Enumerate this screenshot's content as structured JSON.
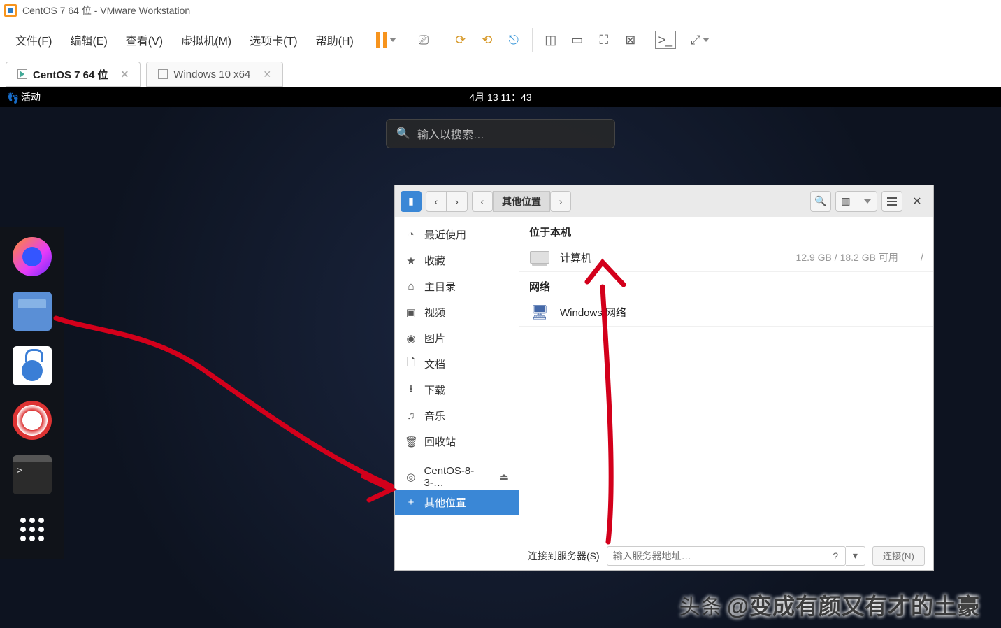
{
  "titlebar": {
    "text": "CentOS 7 64 位 - VMware Workstation"
  },
  "menubar": {
    "items": [
      "文件(F)",
      "编辑(E)",
      "查看(V)",
      "虚拟机(M)",
      "选项卡(T)",
      "帮助(H)"
    ]
  },
  "vm_tabs": {
    "active": "CentOS 7 64 位",
    "inactive": "Windows 10 x64"
  },
  "gnome": {
    "activities": "活动",
    "clock": "4月 13  11：43",
    "search_placeholder": "输入以搜索…"
  },
  "nautilus": {
    "breadcrumb": "其他位置",
    "header_icons": {
      "back": "‹",
      "fwd": "›",
      "bcbtn": "‹",
      "bcfwd": "›",
      "search": "🔍",
      "list": "▥",
      "close": "✕"
    },
    "sidebar": [
      {
        "icon": "◔",
        "label": "最近使用"
      },
      {
        "icon": "★",
        "label": "收藏"
      },
      {
        "icon": "⌂",
        "label": "主目录"
      },
      {
        "icon": "▣",
        "label": "视频"
      },
      {
        "icon": "◉",
        "label": "图片"
      },
      {
        "icon": "🗋",
        "label": "文档"
      },
      {
        "icon": "⭳",
        "label": "下载"
      },
      {
        "icon": "♫",
        "label": "音乐"
      },
      {
        "icon": "🗑",
        "label": "回收站"
      }
    ],
    "sidebar_disc": {
      "icon": "◎",
      "label": "CentOS-8-3-…",
      "eject": "⏏"
    },
    "sidebar_other": {
      "icon": "+",
      "label": "其他位置"
    },
    "main": {
      "local_header": "位于本机",
      "computer": {
        "label": "计算机",
        "info": "12.9 GB / 18.2 GB 可用",
        "slash": "/"
      },
      "network_header": "网络",
      "winnet": {
        "label": "Windows 网络"
      }
    },
    "footer": {
      "server_label": "连接到服务器(S)",
      "server_placeholder": "输入服务器地址…",
      "q": "?",
      "dd": "▾",
      "connect": "连接(N)"
    }
  },
  "watermark": {
    "pre": "头条",
    "main": "@变成有颜又有才的土豪"
  }
}
